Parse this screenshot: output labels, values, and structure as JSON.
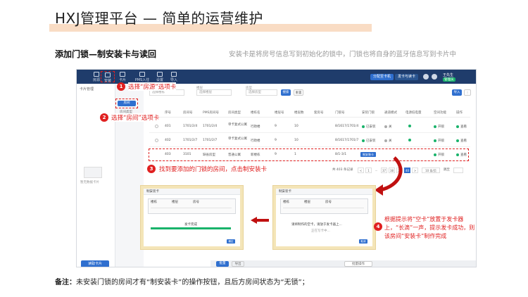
{
  "header": {
    "title": "HXJ管理平台 — 简单的运营维护",
    "section_title": "添加门锁—制安装卡与读回",
    "section_desc": "安装卡是将房号信息写到初始化的锁中，门锁也将自身的蓝牙信息写到卡片中"
  },
  "app": {
    "nav": [
      {
        "label": "房源"
      },
      {
        "label": "安装"
      },
      {
        "label": "卡片"
      },
      {
        "label": "PMS入住"
      },
      {
        "label": "设置"
      },
      {
        "label": "导入"
      }
    ],
    "top_buttons": {
      "primary": "分配至卡机",
      "secondary": "发卡与读卡"
    },
    "user": {
      "name": "王先生",
      "tag": "管理员"
    },
    "left_label": "卡片管理",
    "left_empty_text": "暂无数据卡片",
    "left_bottom_button": "读取卡片",
    "tree_button": "房间",
    "tree_label": "房间类型",
    "filters": [
      {
        "label": "楼栋",
        "value": "选择楼栋"
      },
      {
        "label": "楼层",
        "value": "选择楼层"
      },
      {
        "label": "房型",
        "value": "选择房型"
      }
    ],
    "search_button": "搜索",
    "reset_button": "重置",
    "add_button": "导入",
    "columns": [
      "序号",
      "房间号",
      "PMS房间号",
      "房间类型",
      "楼栋名",
      "楼层号",
      "楼层数",
      "套房号",
      "门锁号",
      "安装门锁",
      "通道模式",
      "电源低电量",
      "空间功能",
      "操作"
    ],
    "rows": [
      {
        "no": "401",
        "room": "1701/2/4",
        "pms": "1701/2/4",
        "type": "单卡复式公寓",
        "building": "行政楼",
        "floor": "9",
        "floors": "10",
        "suite": "",
        "lock": "8/1617/1701/4",
        "installed": "已安装",
        "channel": "关",
        "power": "",
        "func": "开锁",
        "op": "查看"
      },
      {
        "no": "402",
        "room": "1701/2/7",
        "pms": "1701/2/7",
        "type": "单卡复式公寓",
        "building": "行政楼",
        "floor": "9",
        "floors": "10",
        "suite": "",
        "lock": "8/1617/1701/7",
        "installed": "已安装",
        "channel": "关",
        "power": "",
        "func": "开锁",
        "op": "查看"
      },
      {
        "no": "403",
        "room": "3101",
        "pms": "缺省房型",
        "type": "普通公寓",
        "building": "新楼栋",
        "floor": "9",
        "floors": "1",
        "suite": "",
        "lock": "8/1-3/1",
        "installed": "制安装卡",
        "channel": "",
        "power": "",
        "func": "开锁",
        "op": "查看"
      }
    ],
    "pager": {
      "total": "共 403 条记录",
      "pages": [
        "<",
        "1",
        "...",
        "37",
        "38",
        "39",
        "40",
        ">"
      ],
      "active": "40",
      "per_page": "10 条/页",
      "goto": "跳至"
    },
    "bottom_buttons": {
      "b1": "批量",
      "b2": "导出",
      "b3": "批量操作"
    }
  },
  "steps": [
    {
      "n": "1",
      "text": "选择“房源”选项卡"
    },
    {
      "n": "2",
      "text": "选择“房间”选项卡"
    },
    {
      "n": "3",
      "text": "找到要添加的门锁的房间，点击制安装卡"
    },
    {
      "n": "4",
      "text": "根据提示将“空卡”放置于发卡器上，“长滴”一声，提示发卡成功，则该房间“安装卡”制作完成"
    }
  ],
  "dialog_left": {
    "title": "制安装卡",
    "col_a": "楼栋",
    "col_b": "楼层",
    "col_c": "房号",
    "status": "发卡完成",
    "progress": 1.0,
    "ok": "确定"
  },
  "dialog_right": {
    "title": "制安装卡",
    "col_a": "楼栋",
    "col_b": "楼层",
    "col_c": "房号",
    "prompt": "请将制作的空卡，请放于发卡器上...",
    "hint": "正在写卡中...",
    "ok": "取消"
  },
  "note": {
    "label": "备注：",
    "text": "未安装门锁的房间才有“制安装卡”的操作按钮，且后方房间状态为“无锁”；"
  },
  "colors": {
    "accent": "#e02020",
    "brand": "#1f3c6b",
    "primary": "#2f6fcf",
    "success": "#19b36b",
    "title_band": "#f9dcc4"
  }
}
